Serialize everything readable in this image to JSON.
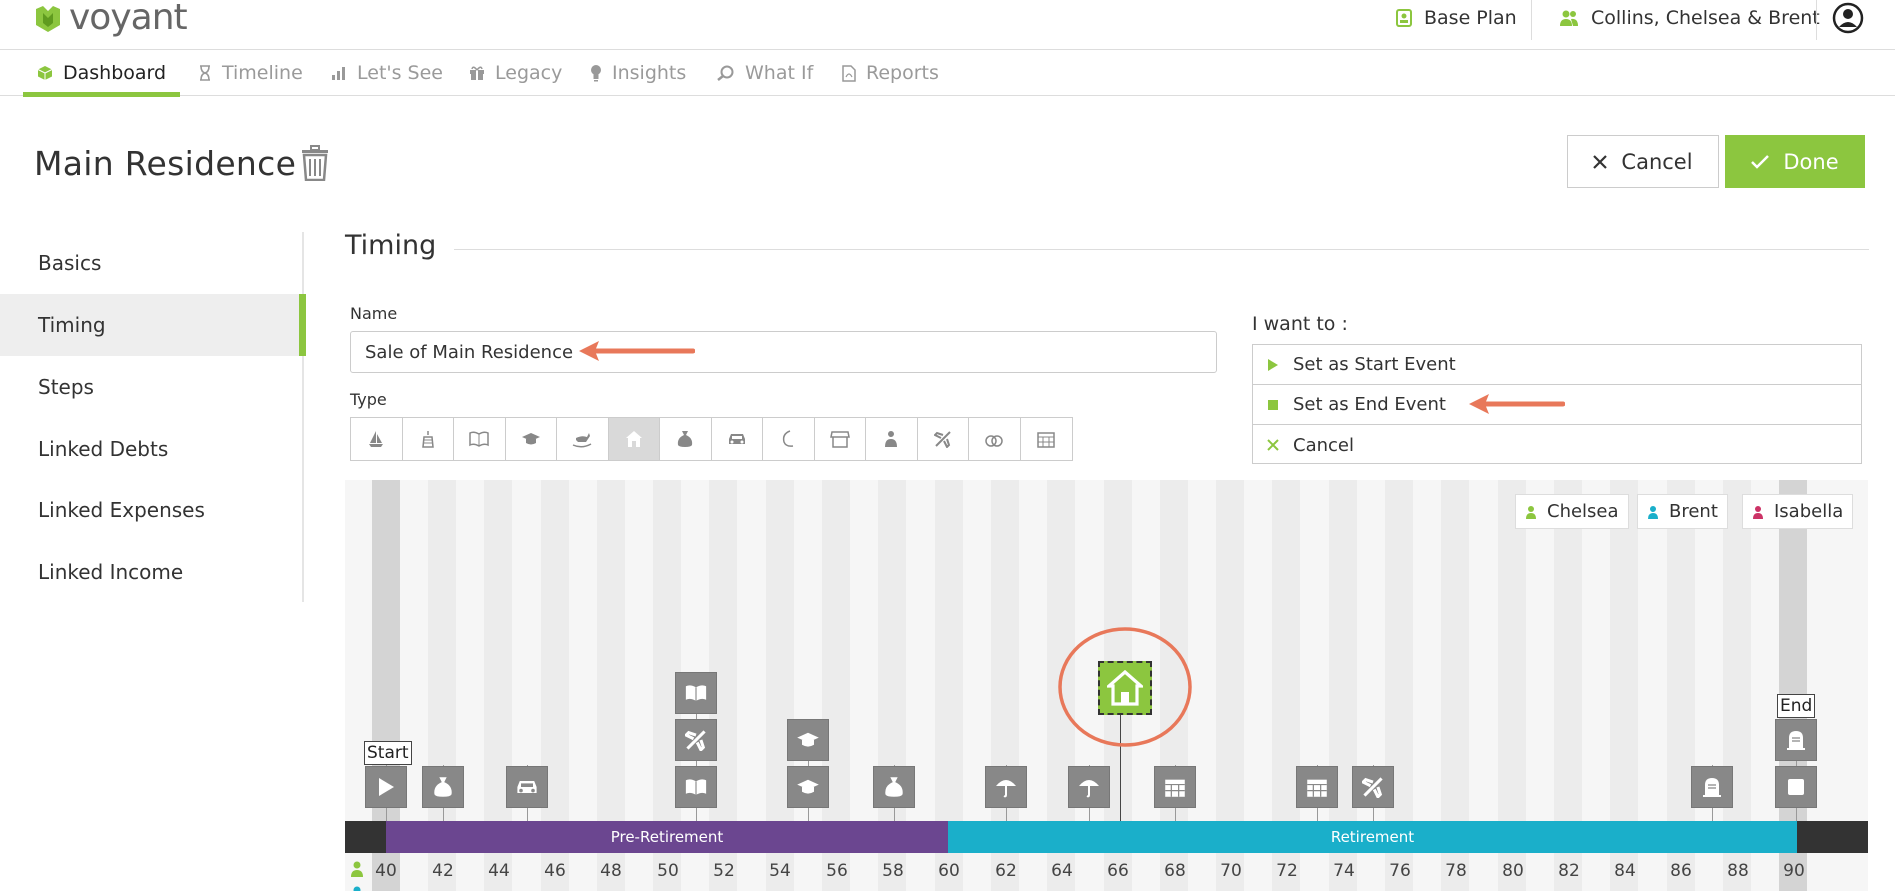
{
  "header": {
    "logo_text": "voyant",
    "plan": "Base Plan",
    "clients": "Collins, Chelsea & Brent"
  },
  "nav": {
    "tabs": [
      {
        "label": "Dashboard",
        "icon": "cube-icon",
        "active": true
      },
      {
        "label": "Timeline",
        "icon": "hourglass-icon"
      },
      {
        "label": "Let's See",
        "icon": "bar-chart-icon"
      },
      {
        "label": "Legacy",
        "icon": "gift-icon"
      },
      {
        "label": "Insights",
        "icon": "lightbulb-icon"
      },
      {
        "label": "What If",
        "icon": "magnify-icon"
      },
      {
        "label": "Reports",
        "icon": "pdf-icon"
      }
    ]
  },
  "page": {
    "title": "Main Residence",
    "cancel_label": "Cancel",
    "done_label": "Done"
  },
  "sidebar": {
    "items": [
      {
        "label": "Basics"
      },
      {
        "label": "Timing",
        "active": true
      },
      {
        "label": "Steps"
      },
      {
        "label": "Linked Debts"
      },
      {
        "label": "Linked Expenses"
      },
      {
        "label": "Linked Income"
      }
    ]
  },
  "timing": {
    "section_title": "Timing",
    "name_label": "Name",
    "name_value": "Sale of Main Residence",
    "type_label": "Type",
    "types": [
      "sailboat-icon",
      "cake-icon",
      "book-icon",
      "graduation-cap-icon",
      "rocking-horse-icon",
      "house-icon",
      "money-bag-icon",
      "car-icon",
      "moon-icon",
      "awning-icon",
      "people-icon",
      "airplane-icon",
      "rings-icon",
      "calendar-icon"
    ],
    "selected_type": "house-icon",
    "i_want_label": "I want to :",
    "actions": [
      {
        "label": "Set as Start Event",
        "icon": "play-icon",
        "color": "#8cc63f"
      },
      {
        "label": "Set as End Event",
        "icon": "stop-icon",
        "color": "#8cc63f"
      },
      {
        "label": "Cancel",
        "icon": "x-icon",
        "color": "#8cc63f"
      }
    ]
  },
  "timeline": {
    "legend": [
      {
        "name": "Chelsea",
        "color": "#8cc63f"
      },
      {
        "name": "Brent",
        "color": "#1aafca"
      },
      {
        "name": "Isabella",
        "color": "#cc3366"
      }
    ],
    "start_flag": "Start",
    "end_flag": "End",
    "phases": [
      {
        "label": "Pre-Retirement",
        "color": "#6b4690"
      },
      {
        "label": "Retirement",
        "color": "#1aafca"
      }
    ],
    "ages": [
      "40",
      "42",
      "44",
      "46",
      "48",
      "50",
      "52",
      "54",
      "56",
      "58",
      "60",
      "62",
      "64",
      "66",
      "68",
      "70",
      "72",
      "74",
      "76",
      "78",
      "80",
      "82",
      "84",
      "86",
      "88",
      "90"
    ]
  },
  "colors": {
    "accent": "#8cc63f",
    "annotation": "#e8785a"
  }
}
